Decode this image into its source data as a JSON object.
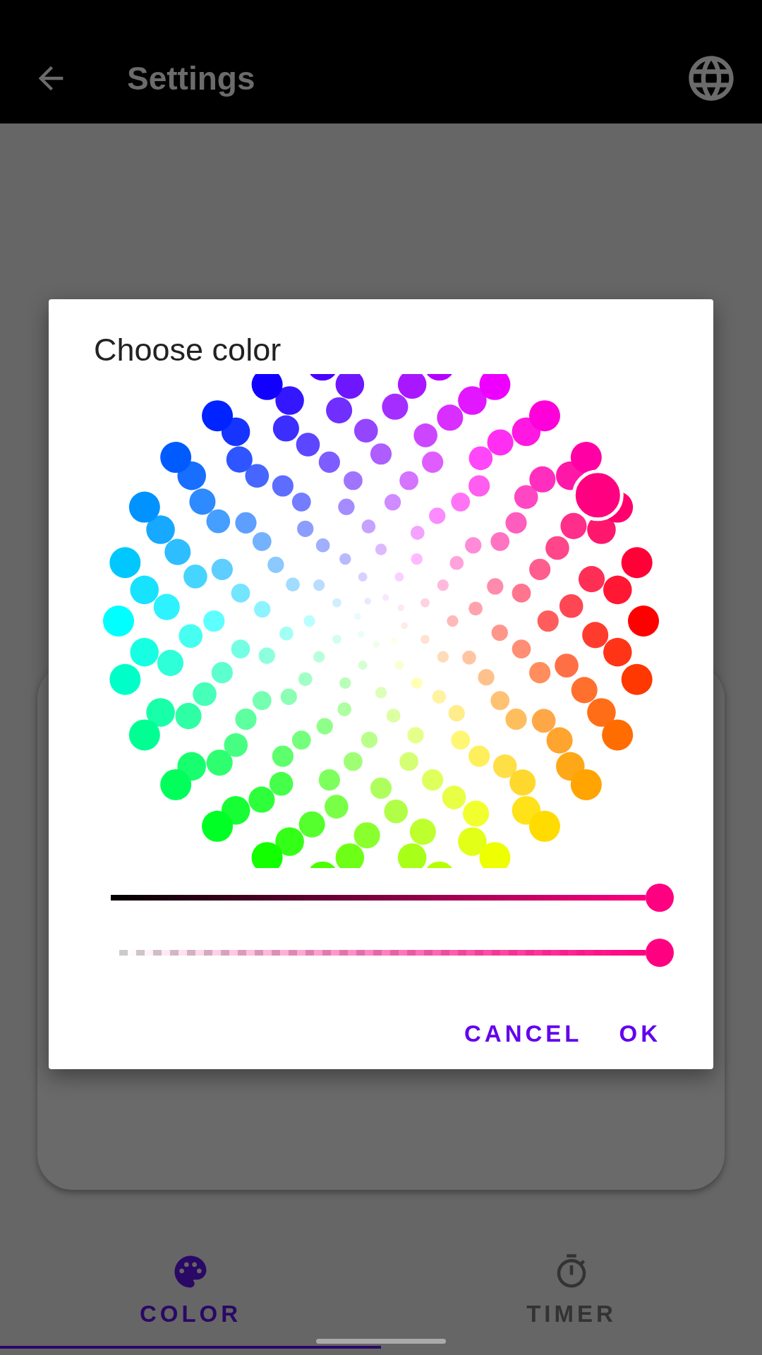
{
  "app_bar": {
    "title": "Settings"
  },
  "dialog": {
    "title": "Choose color",
    "picker": {
      "color": "#ff0080"
    },
    "sliders": [
      {
        "kind": "brightness",
        "level": 1
      },
      {
        "kind": "alpha",
        "level": 1
      }
    ],
    "buttons": [
      "CANCEL",
      "OK"
    ]
  },
  "tabs": [
    {
      "kind": "palette",
      "label": "COLOR",
      "selected": true
    },
    {
      "kind": "timer",
      "label": "TIMER",
      "selected": false
    }
  ]
}
